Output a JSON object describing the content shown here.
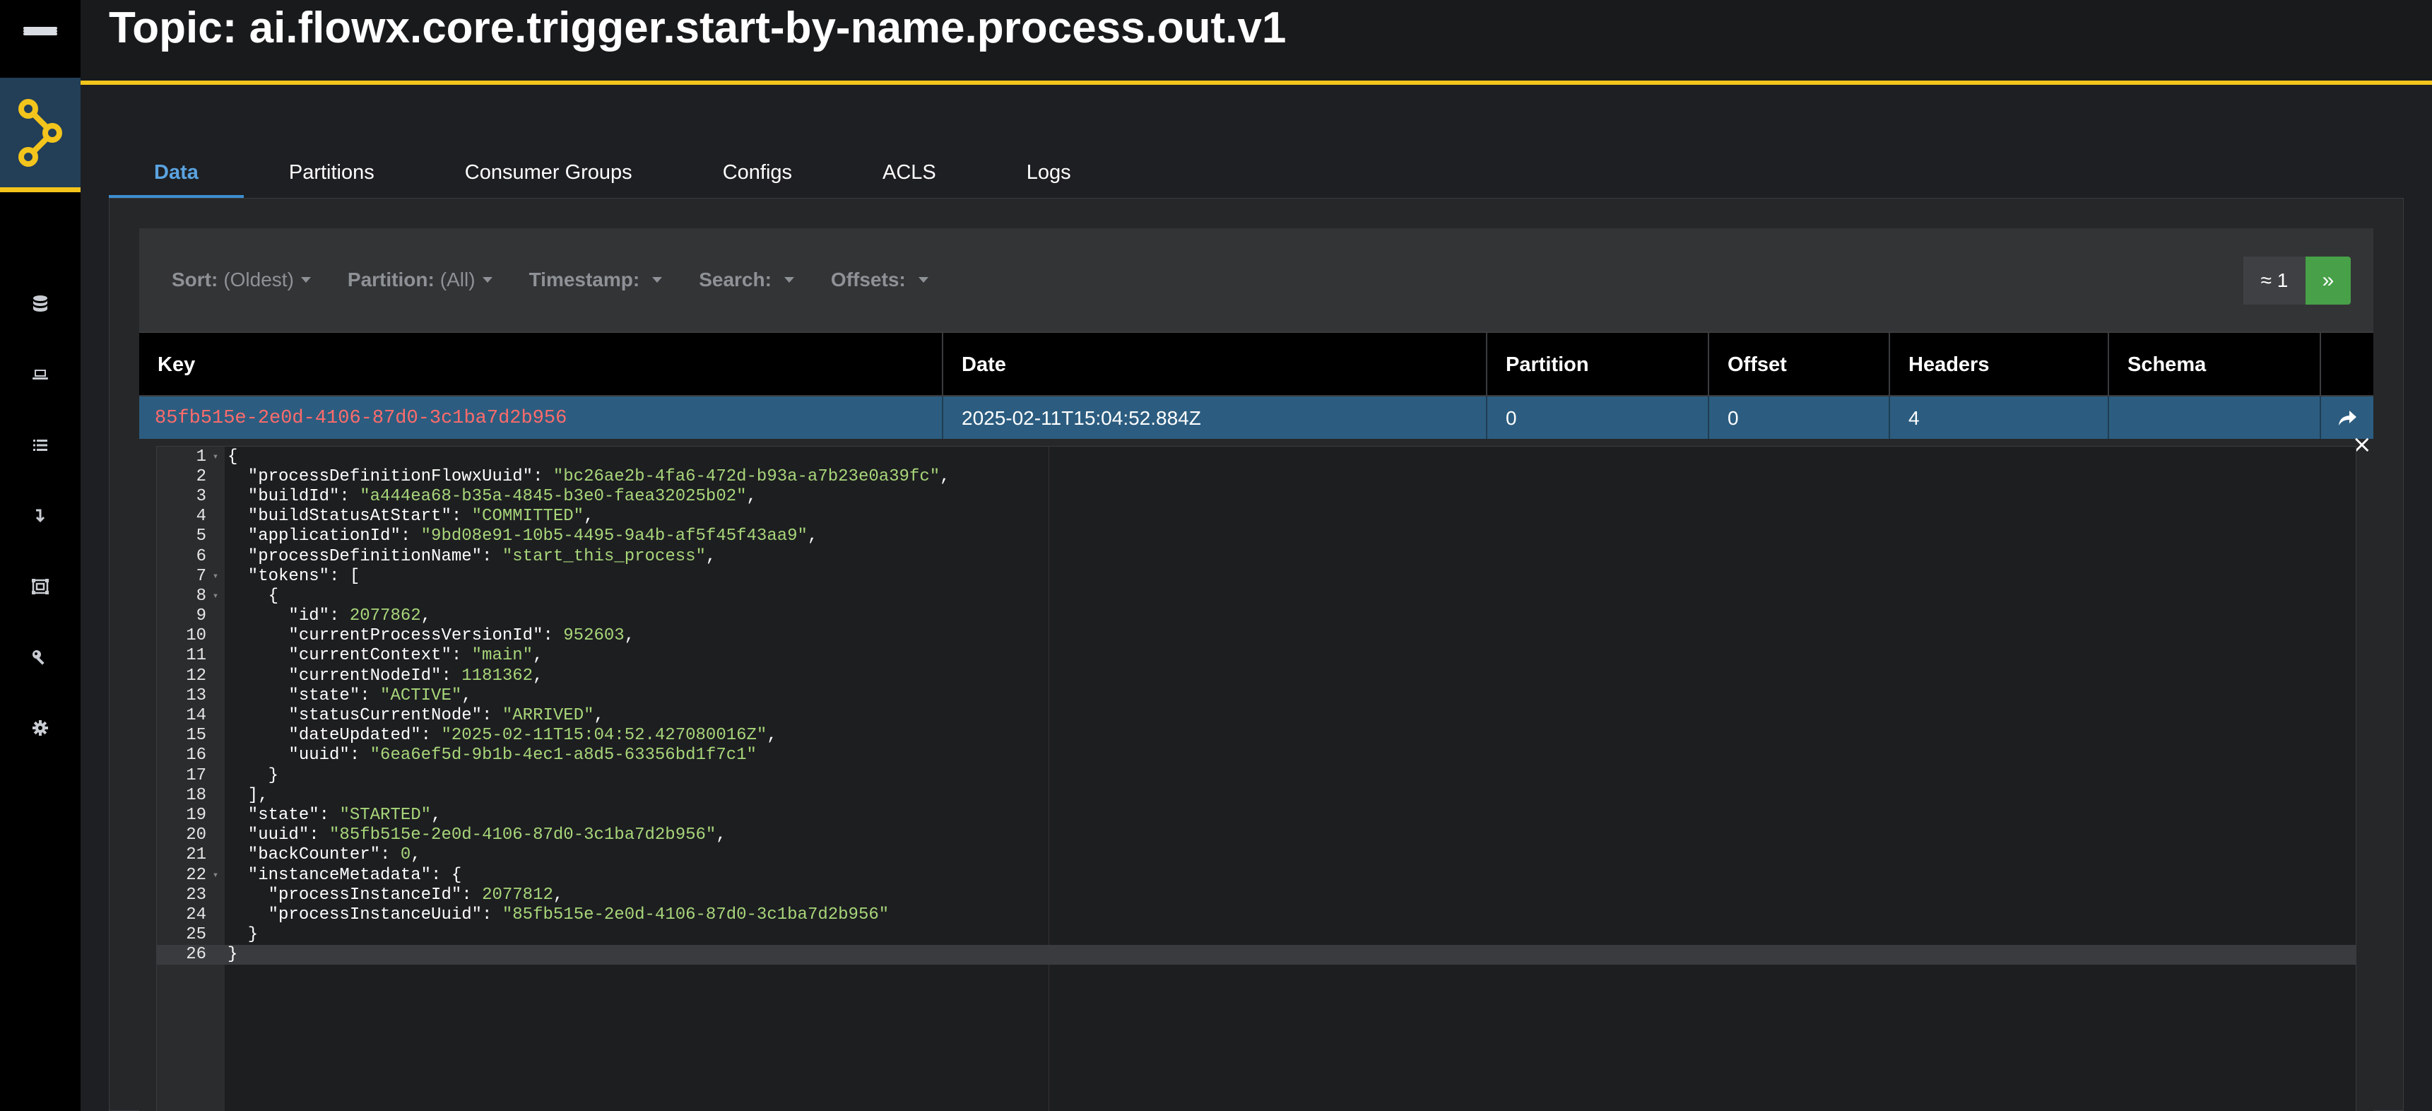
{
  "page": {
    "title": "Topic: ai.flowx.core.trigger.start-by-name.process.out.v1"
  },
  "sidebar": {
    "items": [
      {
        "name": "database-icon"
      },
      {
        "name": "laptop-icon"
      },
      {
        "name": "list-icon"
      },
      {
        "name": "arrow-down-icon"
      },
      {
        "name": "schema-icon"
      },
      {
        "name": "key-icon"
      },
      {
        "name": "gear-icon"
      }
    ]
  },
  "tabs": [
    {
      "label": "Data",
      "active": true
    },
    {
      "label": "Partitions"
    },
    {
      "label": "Consumer Groups"
    },
    {
      "label": "Configs"
    },
    {
      "label": "ACLS"
    },
    {
      "label": "Logs"
    }
  ],
  "toolbar": {
    "sort_label": "Sort:",
    "sort_value": "(Oldest)",
    "partition_label": "Partition:",
    "partition_value": "(All)",
    "timestamp_label": "Timestamp:",
    "search_label": "Search:",
    "offsets_label": "Offsets:",
    "page_count": "≈ 1",
    "next_label": "»"
  },
  "table": {
    "headers": [
      "Key",
      "Date",
      "Partition",
      "Offset",
      "Headers",
      "Schema"
    ],
    "row": {
      "key": "85fb515e-2e0d-4106-87d0-3c1ba7d2b956",
      "date": "2025-02-11T15:04:52.884Z",
      "partition": "0",
      "offset": "0",
      "headers": "4",
      "schema": ""
    }
  },
  "detail": {
    "close": "×",
    "lines": [
      {
        "n": "1",
        "fold": "▾",
        "text": "{"
      },
      {
        "n": "2",
        "text": "  \"processDefinitionFlowxUuid\": ",
        "val": "\"bc26ae2b-4fa6-472d-b93a-a7b23e0a39fc\"",
        "tail": ","
      },
      {
        "n": "3",
        "text": "  \"buildId\": ",
        "val": "\"a444ea68-b35a-4845-b3e0-faea32025b02\"",
        "tail": ","
      },
      {
        "n": "4",
        "text": "  \"buildStatusAtStart\": ",
        "val": "\"COMMITTED\"",
        "tail": ","
      },
      {
        "n": "5",
        "text": "  \"applicationId\": ",
        "val": "\"9bd08e91-10b5-4495-9a4b-af5f45f43aa9\"",
        "tail": ","
      },
      {
        "n": "6",
        "text": "  \"processDefinitionName\": ",
        "val": "\"start_this_process\"",
        "tail": ","
      },
      {
        "n": "7",
        "fold": "▾",
        "text": "  \"tokens\": ["
      },
      {
        "n": "8",
        "fold": "▾",
        "text": "    {"
      },
      {
        "n": "9",
        "text": "      \"id\": ",
        "val": "2077862",
        "tail": ","
      },
      {
        "n": "10",
        "text": "      \"currentProcessVersionId\": ",
        "val": "952603",
        "tail": ","
      },
      {
        "n": "11",
        "text": "      \"currentContext\": ",
        "val": "\"main\"",
        "tail": ","
      },
      {
        "n": "12",
        "text": "      \"currentNodeId\": ",
        "val": "1181362",
        "tail": ","
      },
      {
        "n": "13",
        "text": "      \"state\": ",
        "val": "\"ACTIVE\"",
        "tail": ","
      },
      {
        "n": "14",
        "text": "      \"statusCurrentNode\": ",
        "val": "\"ARRIVED\"",
        "tail": ","
      },
      {
        "n": "15",
        "text": "      \"dateUpdated\": ",
        "val": "\"2025-02-11T15:04:52.427080016Z\"",
        "tail": ","
      },
      {
        "n": "16",
        "text": "      \"uuid\": ",
        "val": "\"6ea6ef5d-9b1b-4ec1-a8d5-63356bd1f7c1\"",
        "tail": ""
      },
      {
        "n": "17",
        "text": "    }"
      },
      {
        "n": "18",
        "text": "  ],"
      },
      {
        "n": "19",
        "text": "  \"state\": ",
        "val": "\"STARTED\"",
        "tail": ","
      },
      {
        "n": "20",
        "text": "  \"uuid\": ",
        "val": "\"85fb515e-2e0d-4106-87d0-3c1ba7d2b956\"",
        "tail": ","
      },
      {
        "n": "21",
        "text": "  \"backCounter\": ",
        "val": "0",
        "tail": ","
      },
      {
        "n": "22",
        "fold": "▾",
        "text": "  \"instanceMetadata\": {"
      },
      {
        "n": "23",
        "text": "    \"processInstanceId\": ",
        "val": "2077812",
        "tail": ","
      },
      {
        "n": "24",
        "text": "    \"processInstanceUuid\": ",
        "val": "\"85fb515e-2e0d-4106-87d0-3c1ba7d2b956\"",
        "tail": ""
      },
      {
        "n": "25",
        "text": "  }"
      },
      {
        "n": "26",
        "text": "}",
        "highlight": true
      }
    ]
  },
  "colors": {
    "accent_yellow": "#f3c41b",
    "tab_active": "#5aa3e0",
    "row_selected": "#2c5d80",
    "key_red": "#ff6b6b",
    "string_green": "#a8d67a",
    "next_button": "#48a048"
  }
}
